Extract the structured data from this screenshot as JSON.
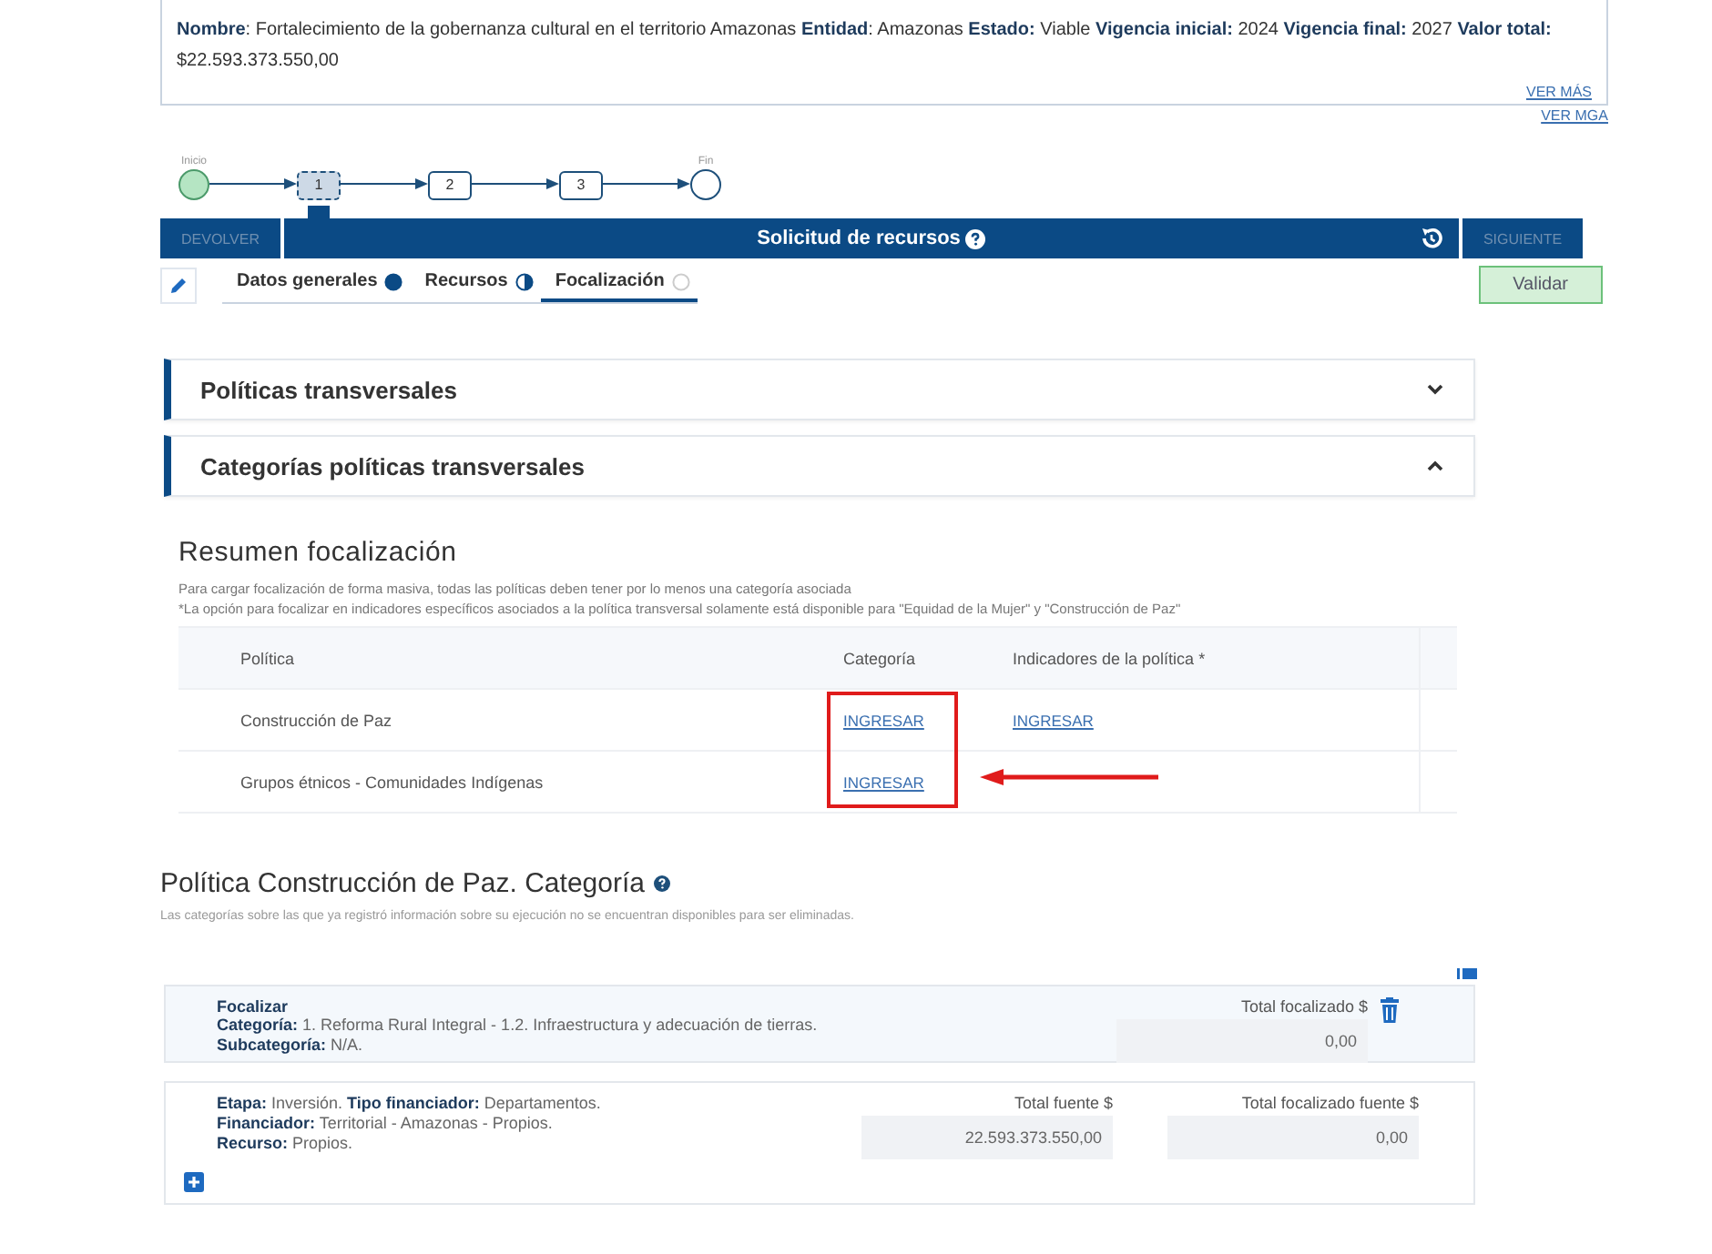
{
  "project_info": {
    "text": "**Nombre**: Fortalecimiento de la gobernanza cultural en el territorio Amazonas **Entidad**: Amazonas **Estado:** Viable **Vigencia inicial:** 2024 **Vigencia final:** 2027 **Valor total:** $22.593.373.550,00",
    "links": [
      "VER MÁS",
      "VER MGA"
    ]
  },
  "stepper": {
    "start_label": "Inicio",
    "end_label": "Fin",
    "steps": [
      {
        "label": "1",
        "selected": true
      },
      {
        "label": "2",
        "selected": false
      },
      {
        "label": "3",
        "selected": false
      }
    ]
  },
  "action_bar": {
    "back_button": "DEVOLVER",
    "title": "Solicitud de recursos",
    "next_button": "SIGUIENTE"
  },
  "section_tabs": [
    {
      "label": "Datos generales",
      "kind": "complete",
      "selected": false
    },
    {
      "label": "Recursos",
      "kind": "partial",
      "selected": false
    },
    {
      "label": "Focalización",
      "kind": "empty",
      "selected": true
    }
  ],
  "validate_button": "Validar",
  "accordions": [
    {
      "title": "Políticas transversales",
      "expanded": false
    },
    {
      "title": "Categorías políticas transversales",
      "expanded": true
    }
  ],
  "summary": {
    "title": "Resumen focalización",
    "notes": [
      "Para cargar focalización de forma masiva, todas las políticas deben tener por lo menos una categoría asociada",
      "*La opción para focalizar en indicadores específicos asociados a la política transversal solamente está disponible para \"Equidad de la Mujer\" y \"Construcción de Paz\""
    ],
    "columns": [
      "Política",
      "Categoría",
      "Indicadores de la política *"
    ],
    "rows": [
      {
        "policy": "Construcción de Paz",
        "category_link": "INGRESAR",
        "indicators_link": "INGRESAR"
      },
      {
        "policy": "Grupos étnicos - Comunidades Indígenas",
        "category_link": "INGRESAR"
      }
    ],
    "annotation_shown": true
  },
  "category_section": {
    "title": "Política Construcción de Paz. Categoría",
    "subtitle": "Las categorías sobre las que ya registró información sobre su ejecución no se encuentran disponibles para ser eliminadas.",
    "focus_card": {
      "heading": "Focalizar",
      "lines": [
        "**Categoría:** 1. Reforma Rural Integral - 1.2. Infraestructura y adecuación de tierras.",
        "**Subcategoría:** N/A."
      ],
      "total_label": "Total focalizado $",
      "total_value": "0,00"
    },
    "source_card": {
      "lines": [
        "**Etapa:** Inversión. **Tipo financiador:** Departamentos.",
        "**Financiador:** Territorial - Amazonas - Propios.",
        "**Recurso:** Propios."
      ],
      "source_label": "Total fuente $",
      "source_value": "22.593.373.550,00",
      "focused_label": "Total focalizado fuente $",
      "focused_value": "0,00"
    }
  }
}
